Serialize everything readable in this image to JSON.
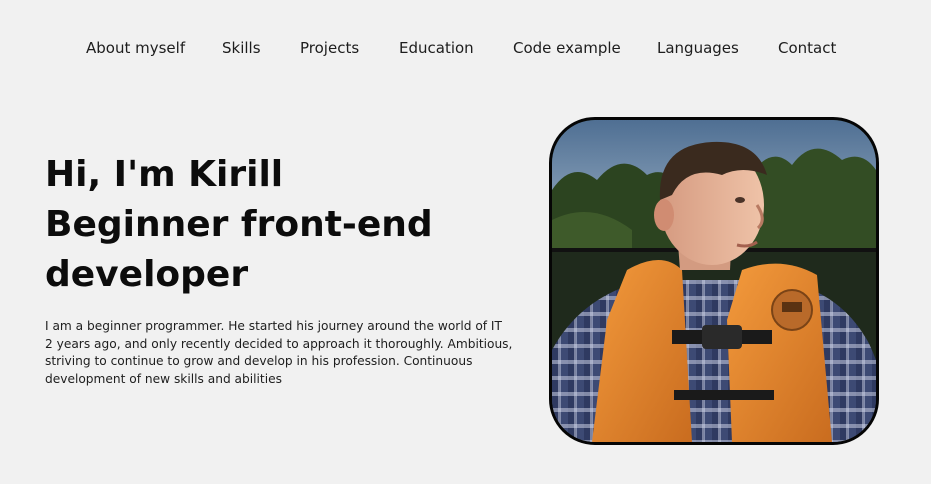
{
  "nav": {
    "items": [
      {
        "label": "About myself"
      },
      {
        "label": "Skills"
      },
      {
        "label": "Projects"
      },
      {
        "label": "Education"
      },
      {
        "label": "Code example"
      },
      {
        "label": "Languages"
      },
      {
        "label": "Contact"
      }
    ]
  },
  "hero": {
    "greeting": "Hi, I'm Kirill",
    "role_line1": "Beginner front-end",
    "role_line2": "developer",
    "description": "I am a beginner programmer. He started his journey around the world of IT 2 years ago, and only recently decided to approach it thoroughly. Ambitious, striving to continue to grow and develop in his profession. Continuous development of new skills and abilities"
  },
  "photo": {
    "subject": "portrait of Kirill wearing an orange life vest",
    "border_color": "#050505",
    "vest_color": "#e3872e"
  },
  "colors": {
    "background": "#f1f1f1",
    "text": "#111111"
  }
}
